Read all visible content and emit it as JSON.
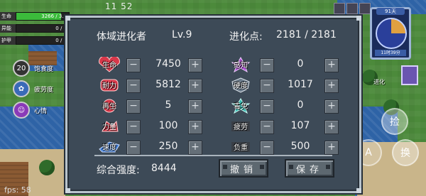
{
  "hud": {
    "bars": [
      {
        "label": "生命",
        "value": "3266 / 3...",
        "fill": 0.85,
        "color": "#3bbb3b"
      },
      {
        "label": "异能",
        "value": "0 / 0",
        "fill": 0,
        "color": "#3a8ad8"
      },
      {
        "label": "护甲",
        "value": "0 / 0",
        "fill": 0,
        "color": "#b0b0b0"
      }
    ],
    "clock": "11 52",
    "status": [
      {
        "icon": "hunger-icon",
        "glyph": "20",
        "label": "饱食度"
      },
      {
        "icon": "fatigue-icon",
        "glyph": "✿",
        "label": "疲劳度"
      },
      {
        "icon": "mood-icon",
        "glyph": "☺",
        "label": "心情"
      }
    ],
    "fps": "fps: 58",
    "minimap": {
      "day_label": "91天",
      "time_label": "11时39分"
    },
    "pickup_button": "捡",
    "switch_button": "换",
    "attack_button": "A",
    "map_label": "进化"
  },
  "panel": {
    "title": "体域进化者",
    "level": "Lv.9",
    "points_label": "进化点:",
    "points": "2181 / 2181",
    "left_stats": [
      {
        "label": "生命",
        "value": "7450",
        "color": "#d8384a"
      },
      {
        "label": "耐力",
        "value": "5812",
        "color": "#d8384a"
      },
      {
        "label": "再生",
        "value": "5",
        "color": "#d8384a"
      },
      {
        "label": "力量",
        "value": "100",
        "color": "#d8384a"
      },
      {
        "label": "速度",
        "value": "250",
        "color": "#3a7ad8"
      }
    ],
    "right_stats": [
      {
        "label": "感知",
        "value": "0",
        "color": "#b04ad8"
      },
      {
        "label": "硬度",
        "value": "1017",
        "color": "#6a7a8a"
      },
      {
        "label": "毒免",
        "value": "0",
        "color": "#38b8b0"
      },
      {
        "label": "疲劳",
        "value": "107",
        "color": "#3a3f46"
      },
      {
        "label": "负重",
        "value": "500",
        "color": "#3a3f46"
      }
    ],
    "minus": "−",
    "plus": "+",
    "total_label": "综合强度:",
    "total": "8444",
    "undo_button": "撤销",
    "save_button": "保存"
  }
}
